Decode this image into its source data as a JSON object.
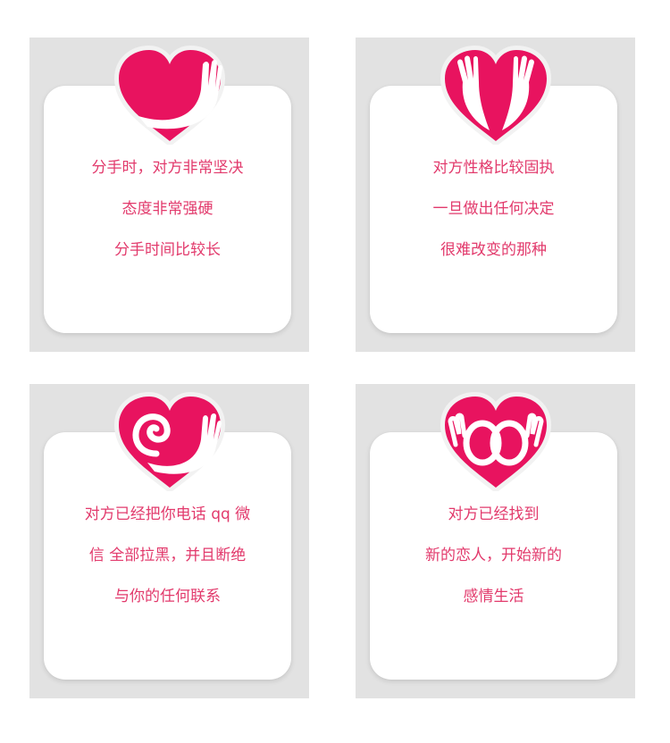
{
  "cards": [
    {
      "icon": "heart-hand-icon",
      "lines": [
        "分手时，对方非常坚决",
        "态度非常强硬",
        "分手时间比较长"
      ]
    },
    {
      "icon": "heart-two-hands-icon",
      "lines": [
        "对方性格比较固执",
        "一旦做出任何决定",
        "很难改变的那种"
      ]
    },
    {
      "icon": "heart-spiral-icon",
      "lines": [
        "对方已经把你电话 qq 微",
        "信 全部拉黑，并且断绝",
        "与你的任何联系"
      ]
    },
    {
      "icon": "heart-linked-hands-icon",
      "lines": [
        "对方已经找到",
        "新的恋人，开始新的",
        "感情生活"
      ]
    }
  ],
  "colors": {
    "accent": "#e8135f",
    "text": "#e23a6c",
    "tile": "#e2e2e2"
  }
}
